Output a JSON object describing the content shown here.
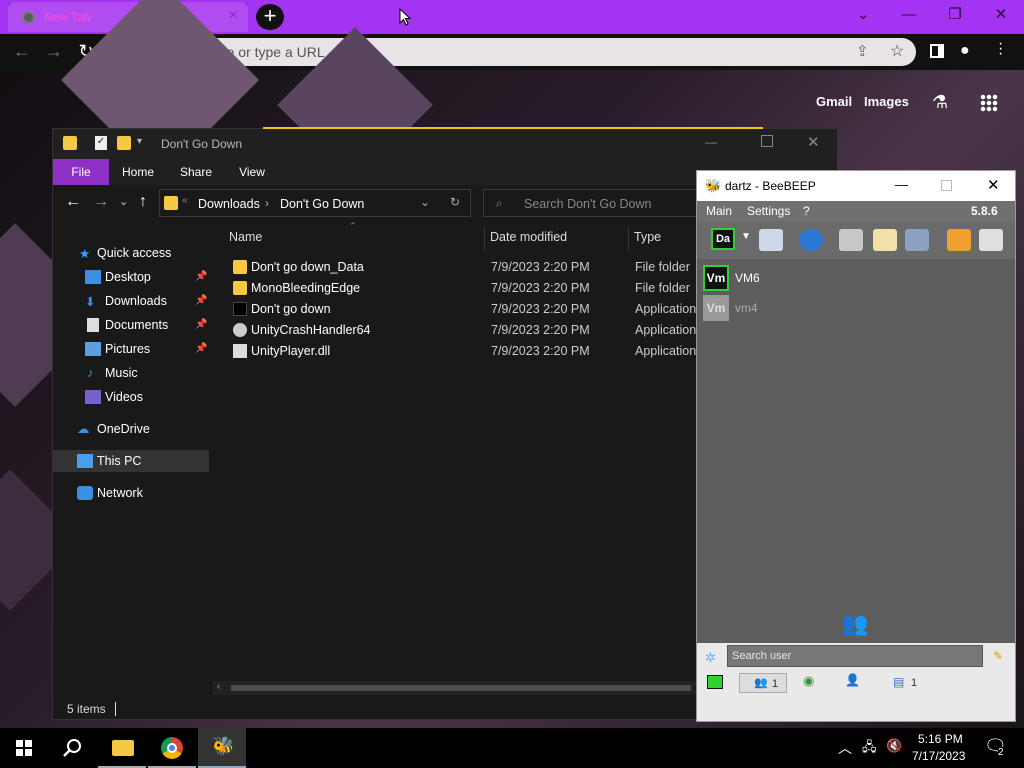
{
  "browser": {
    "tab_title": "New Tab",
    "omnibox_placeholder": "Search Google or type a URL",
    "links": {
      "gmail": "Gmail",
      "images": "Images"
    }
  },
  "explorer": {
    "window_title": "Don't Go Down",
    "ribbon_tabs": [
      "File",
      "Home",
      "Share",
      "View"
    ],
    "breadcrumb": [
      "Downloads",
      "Don't Go Down"
    ],
    "search_placeholder": "Search Don't Go Down",
    "nav": {
      "quick_access": "Quick access",
      "items": [
        "Desktop",
        "Downloads",
        "Documents",
        "Pictures",
        "Music",
        "Videos"
      ],
      "onedrive": "OneDrive",
      "this_pc": "This PC",
      "network": "Network"
    },
    "columns": [
      "Name",
      "Date modified",
      "Type"
    ],
    "files": [
      {
        "name": "Don't go down_Data",
        "date": "7/9/2023 2:20 PM",
        "type": "File folder"
      },
      {
        "name": "MonoBleedingEdge",
        "date": "7/9/2023 2:20 PM",
        "type": "File folder"
      },
      {
        "name": "Don't go down",
        "date": "7/9/2023 2:20 PM",
        "type": "Application"
      },
      {
        "name": "UnityCrashHandler64",
        "date": "7/9/2023 2:20 PM",
        "type": "Application"
      },
      {
        "name": "UnityPlayer.dll",
        "date": "7/9/2023 2:20 PM",
        "type": "Application"
      }
    ],
    "status": "5 items"
  },
  "beebeep": {
    "title": "dartz - BeeBEEP",
    "menu": [
      "Main",
      "Settings",
      "?"
    ],
    "version": "5.8.6",
    "status_label": "Da",
    "users": [
      {
        "avatar": "Vm",
        "name": "VM6"
      },
      {
        "avatar": "Vm",
        "name": "vm4"
      }
    ],
    "search_placeholder": "Search user",
    "tab_counts": [
      "1",
      "1"
    ]
  },
  "taskbar": {
    "time": "5:16 PM",
    "date": "7/17/2023",
    "notification_count": "2"
  },
  "colors": {
    "tab_strip": "#a334f2",
    "tab_title": "#ff4ee0",
    "explorer_file_tab": "#8e2fc5"
  }
}
